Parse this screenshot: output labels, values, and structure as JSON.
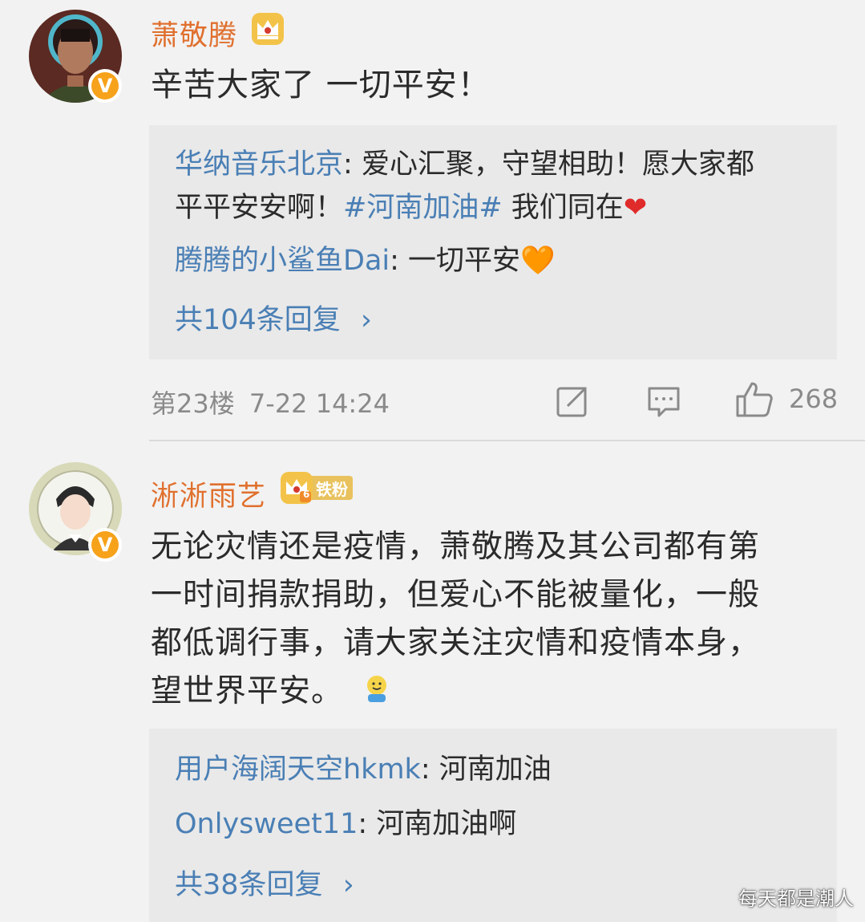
{
  "comments": [
    {
      "username": "萧敬腾",
      "verified_badge": "V",
      "crown_icon": "crown-icon",
      "text_lines": [
        "辛苦大家了 一切平安！"
      ],
      "replies": [
        {
          "user": "华纳音乐北京",
          "sep": ": ",
          "text_line1": "爱心汇聚，守望相助！愿大家都",
          "text_line2_pre": "平平安安啊！",
          "hashtag": "#河南加油#",
          "text_line2_post": " 我们同在",
          "emoji": "❤"
        },
        {
          "user": "腾腾的小鲨鱼Dai",
          "sep": ": ",
          "text": "一切平安",
          "emoji": "🧡"
        }
      ],
      "reply_count_label": "共104条回复",
      "reply_count_chevron": "›",
      "floor": "第23楼",
      "time": "7-22 14:24",
      "like_count": "268"
    },
    {
      "username": "淅淅雨艺",
      "verified_badge": "V",
      "fan_badge_level": "6",
      "fan_badge_label": "铁粉",
      "text_lines": [
        "无论灾情还是疫情，萧敬腾及其公司都有第",
        "一时间捐款捐助，但爱心不能被量化，一般",
        "都低调行事，请大家关注灾情和疫情本身，",
        "望世界平安。"
      ],
      "replies": [
        {
          "user": "用户海阔天空hkmk",
          "sep": ": ",
          "text": "河南加油"
        },
        {
          "user": "Onlysweet11",
          "sep": ": ",
          "text": "河南加油啊"
        }
      ],
      "reply_count_label": "共38条回复",
      "reply_count_chevron": "›"
    }
  ],
  "watermark": "每天都是潮人",
  "colors": {
    "username": "#e0702e",
    "link": "#4a7fb5",
    "meta": "#8a8a8a",
    "reply_bg": "#e9e9e9",
    "page_bg": "#f2f2f2"
  }
}
